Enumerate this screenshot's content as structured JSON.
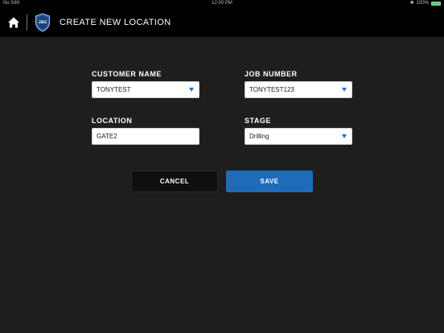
{
  "status_bar": {
    "carrier": "No SIM",
    "time": "12:00 PM",
    "battery": "100%"
  },
  "header": {
    "title": "CREATE NEW LOCATION",
    "logo_text": "J&G",
    "icons": {
      "home": "home-icon",
      "logo": "logo-badge"
    }
  },
  "form": {
    "customer_name": {
      "label": "CUSTOMER NAME",
      "value": "TONYTEST"
    },
    "job_number": {
      "label": "JOB NUMBER",
      "value": "TONYTEST123"
    },
    "location": {
      "label": "LOCATION",
      "value": "GATE2"
    },
    "stage": {
      "label": "STAGE",
      "value": "Drilling"
    }
  },
  "buttons": {
    "cancel": "CANCEL",
    "save": "SAVE"
  },
  "colors": {
    "background": "#1e1e1e",
    "header": "#000000",
    "accent": "#1f6bb8",
    "battery": "#4cd964"
  }
}
